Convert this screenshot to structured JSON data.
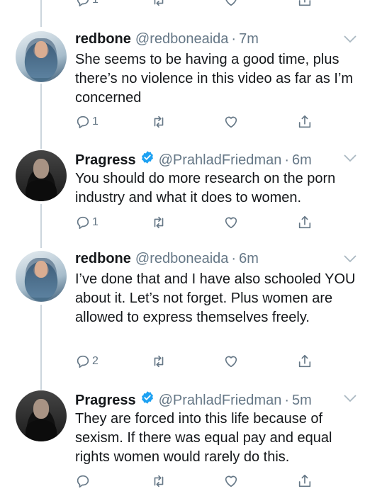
{
  "tweets": [
    {
      "name": "redbone",
      "handle": "@redboneaida",
      "sep": "·",
      "time": "7m",
      "verified": false,
      "text": "She seems to be having a good time, plus there’s no violence in this video as far as I’m concerned",
      "reply_count": "1"
    },
    {
      "name": "Pragress",
      "handle": "@PrahladFriedman",
      "sep": "·",
      "time": "6m",
      "verified": true,
      "text": "You should do more research on the porn industry and what it does to women.",
      "reply_count": "1"
    },
    {
      "name": "redbone",
      "handle": "@redboneaida",
      "sep": "·",
      "time": "6m",
      "verified": false,
      "text": "I’ve done that and I have also schooled YOU about it. Let’s not forget. Plus women are allowed to express themselves freely.",
      "reply_count": "2"
    },
    {
      "name": "Pragress",
      "handle": "@PrahladFriedman",
      "sep": "·",
      "time": "5m",
      "verified": true,
      "text": "They are forced into this life because of sexism. If there was equal pay and equal rights women would rarely do this.",
      "reply_count": ""
    }
  ],
  "top_partial": {
    "reply_count": "1"
  },
  "icons": {
    "reply": "reply-icon",
    "retweet": "retweet-icon",
    "like": "like-icon",
    "share": "share-icon",
    "verified": "verified-badge-icon",
    "menu": "chevron-down-icon"
  },
  "colors": {
    "muted": "#657786",
    "verified": "#1da1f2",
    "thread_line": "#ccd6dd"
  }
}
